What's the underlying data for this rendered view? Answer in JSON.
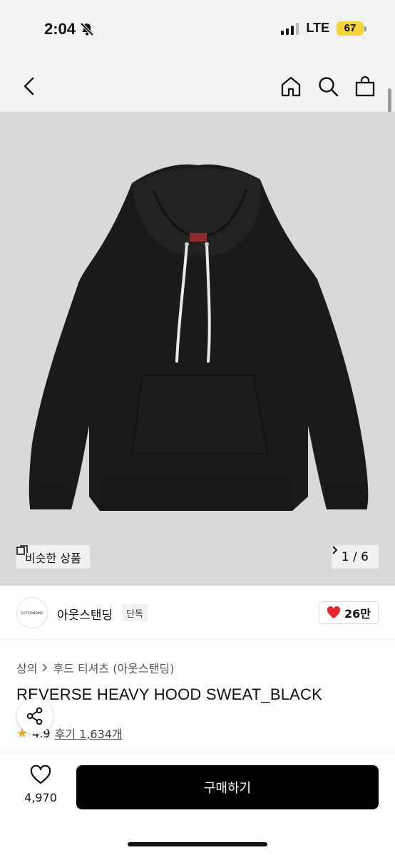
{
  "status_bar": {
    "time": "2:04",
    "network": "LTE",
    "battery": "67",
    "icons": [
      "bell-off-icon",
      "signal-icon",
      "battery-charging-icon"
    ]
  },
  "nav": {
    "icons": [
      "chevron-left-icon",
      "home-icon",
      "search-icon",
      "shopping-bag-icon"
    ]
  },
  "hero": {
    "similar_label": "비슷한 상품",
    "counter": "1 / 6"
  },
  "brand": {
    "logo_text": "OUTSTANDING",
    "name": "아웃스탠딩",
    "tag": "단독",
    "likes": "26만"
  },
  "product": {
    "breadcrumb": [
      "상의",
      "후드 티셔츠 (아웃스탠딩)"
    ],
    "title": "REVERSE HEAVY HOOD SWEAT_BLACK",
    "rating": "4.9",
    "reviews": "후기 1,634개"
  },
  "bottom": {
    "wish_count": "4,970",
    "buy_label": "구매하기"
  },
  "colors": {
    "accent": "#000000",
    "heart": "#e8262e",
    "star": "#f5a623",
    "battery": "#f5d43a"
  }
}
